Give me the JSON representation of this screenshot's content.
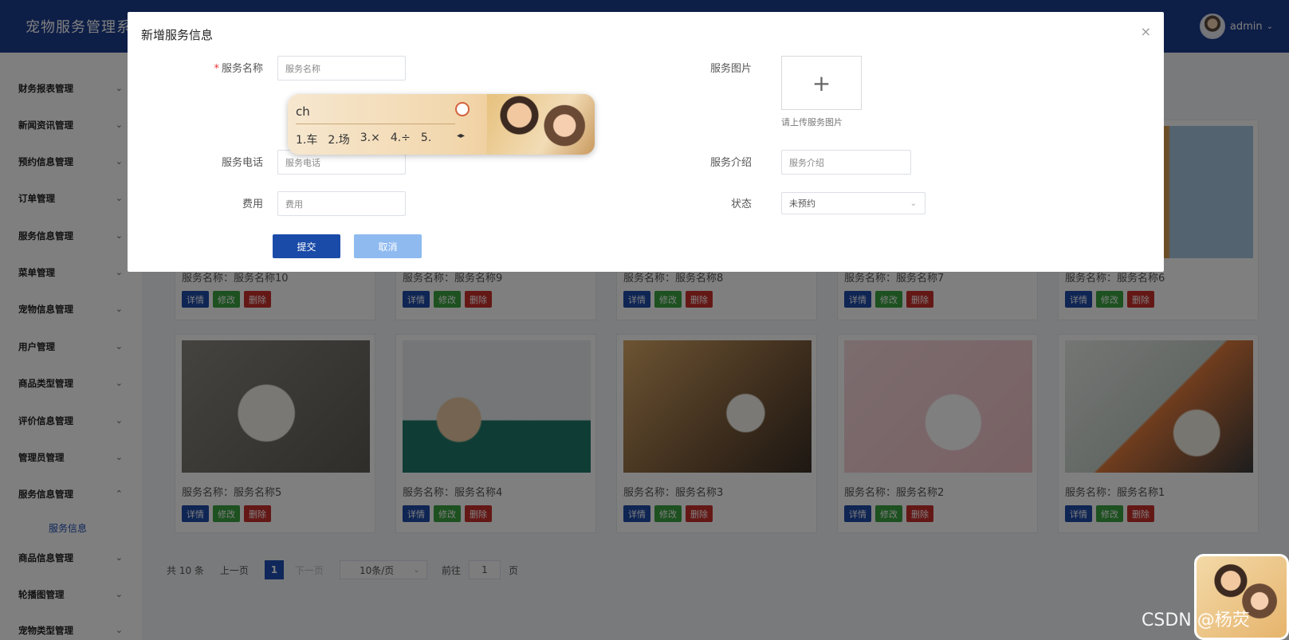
{
  "header": {
    "title": "宠物服务管理系统",
    "user": "admin"
  },
  "sidebar": {
    "items": [
      {
        "label": "财务报表管理",
        "arrow": "⌄"
      },
      {
        "label": "新闻资讯管理",
        "arrow": "⌄"
      },
      {
        "label": "预约信息管理",
        "arrow": "⌄"
      },
      {
        "label": "订单管理",
        "arrow": "⌄"
      },
      {
        "label": "服务信息管理",
        "arrow": "⌄"
      },
      {
        "label": "菜单管理",
        "arrow": "⌄"
      },
      {
        "label": "宠物信息管理",
        "arrow": "⌄"
      },
      {
        "label": "用户管理",
        "arrow": "⌄"
      },
      {
        "label": "商品类型管理",
        "arrow": "⌄"
      },
      {
        "label": "评价信息管理",
        "arrow": "⌄"
      },
      {
        "label": "管理员管理",
        "arrow": "⌄"
      },
      {
        "label": "服务信息管理",
        "arrow": "⌃"
      },
      {
        "label": "商品信息管理",
        "arrow": "⌄"
      },
      {
        "label": "轮播图管理",
        "arrow": "⌄"
      },
      {
        "label": "宠物类型管理",
        "arrow": "⌄"
      }
    ],
    "sub_item": "服务信息"
  },
  "cards": {
    "row1": [
      "服务名称：服务名称10",
      "服务名称：服务名称9",
      "服务名称：服务名称8",
      "服务名称：服务名称7",
      "服务名称：服务名称6"
    ],
    "row2": [
      "服务名称：服务名称5",
      "服务名称：服务名称4",
      "服务名称：服务名称3",
      "服务名称：服务名称2",
      "服务名称：服务名称1"
    ],
    "btn_detail": "详情",
    "btn_edit": "修改",
    "btn_delete": "删除"
  },
  "pagination": {
    "total": "共 10 条",
    "prev": "上一页",
    "current": "1",
    "next": "下一页",
    "page_size": "10条/页",
    "goto": "前往",
    "goto_value": "1",
    "page_unit": "页"
  },
  "dialog": {
    "title": "新增服务信息",
    "close": "×",
    "name_label": "服务名称",
    "name_placeholder": "服务名称",
    "image_label": "服务图片",
    "upload_plus": "+",
    "upload_hint": "请上传服务图片",
    "phone_label": "服务电话",
    "phone_placeholder": "服务电话",
    "intro_label": "服务介绍",
    "intro_placeholder": "服务介绍",
    "fee_label": "费用",
    "fee_placeholder": "费用",
    "status_label": "状态",
    "status_value": "未预约",
    "submit": "提交",
    "cancel": "取消"
  },
  "ime": {
    "input": "ch",
    "candidates": [
      "1.车",
      "2.场",
      "3.×",
      "4.÷",
      "5."
    ]
  },
  "watermark": "CSDN @杨荧",
  "colors": {
    "header": "#1a3c8e",
    "primary": "#1f4fb5",
    "success": "#3aa341",
    "danger": "#c9302c"
  },
  "icons": {
    "close": "close-icon",
    "chevron": "chevron-down-icon",
    "plus": "plus-icon"
  }
}
